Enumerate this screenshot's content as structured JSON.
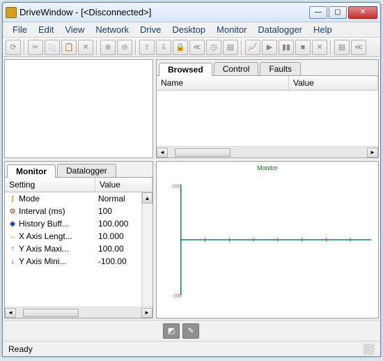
{
  "window": {
    "title": "DriveWindow - [<Disconnected>]",
    "min": "—",
    "max": "▢",
    "close": "✕"
  },
  "menu": [
    "File",
    "Edit",
    "View",
    "Network",
    "Drive",
    "Desktop",
    "Monitor",
    "Datalogger",
    "Help"
  ],
  "browsed": {
    "tabs": [
      "Browsed",
      "Control",
      "Faults"
    ],
    "cols": {
      "name": "Name",
      "value": "Value"
    }
  },
  "monitor": {
    "tabs": [
      "Monitor",
      "Datalogger"
    ],
    "cols": {
      "setting": "Setting",
      "value": "Value"
    },
    "rows": [
      {
        "icon": "∫",
        "color": "#c8a400",
        "setting": "Mode",
        "value": "Normal"
      },
      {
        "icon": "⊙",
        "color": "#cc3333",
        "setting": "Interval (ms)",
        "value": "100"
      },
      {
        "icon": "◆",
        "color": "#2244cc",
        "setting": "History Buff...",
        "value": "100.000"
      },
      {
        "icon": "↔",
        "color": "#cc9900",
        "setting": "X Axis Lengt...",
        "value": "10.000"
      },
      {
        "icon": "↑",
        "color": "#009900",
        "setting": "Y Axis Maxi...",
        "value": "100.00"
      },
      {
        "icon": "↓",
        "color": "#cc0000",
        "setting": "Y Axis Mini...",
        "value": "-100.00"
      }
    ]
  },
  "chart_data": {
    "type": "line",
    "title": "Monitor",
    "xlabel": "",
    "ylabel": "",
    "xlim": [
      0,
      10
    ],
    "ylim": [
      -100,
      100
    ],
    "y_ticks": [
      100,
      0,
      -100
    ],
    "series": [
      {
        "name": "",
        "values": []
      }
    ]
  },
  "status": {
    "text": "Ready"
  }
}
